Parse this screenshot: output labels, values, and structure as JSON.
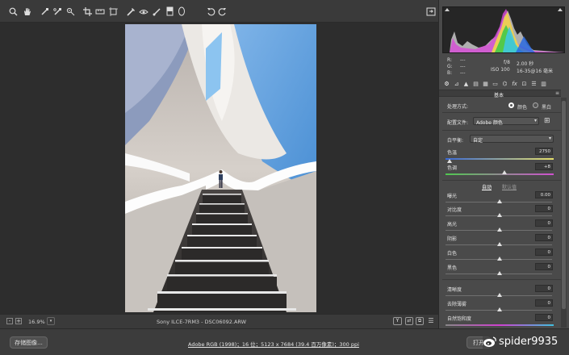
{
  "toolbar": {
    "icons": [
      "zoom-icon",
      "hand-icon",
      "white-balance-icon",
      "color-sampler-icon",
      "target-adjust-icon",
      "crop-icon",
      "straighten-icon",
      "transform-icon",
      "spot-removal-icon",
      "red-eye-icon",
      "adjustment-brush-icon",
      "graduated-filter-icon",
      "radial-filter-icon",
      "rotate-left-icon",
      "rotate-right-icon"
    ],
    "right_icon": "fullscreen-icon"
  },
  "status": {
    "zoom": "16.9%",
    "filename": "Sony ILCE-7RM3  -  DSC06092.ARW"
  },
  "bottom": {
    "save_label": "存储图像...",
    "info_link": "Adobe RGB (1998)；16 位；5123 x 7684 (39.4 百万像素)；300 ppi",
    "open_label": "打开",
    "watermark": "spider9935"
  },
  "histogram": {
    "r_label": "R:",
    "g_label": "G:",
    "b_label": "B:",
    "r_val": "---",
    "g_val": "---",
    "b_val": "---",
    "aperture": "f/8",
    "shutter": "2.00 秒",
    "iso": "ISO 100",
    "lens": "16-35@16 毫米"
  },
  "panel": {
    "section_title": "基本",
    "treatment_label": "处理方式:",
    "color_option": "颜色",
    "bw_option": "黑白",
    "profile_label": "配置文件:",
    "profile_value": "Adobe 颜色",
    "wb_label": "白平衡:",
    "wb_value": "自定",
    "temp_label": "色温",
    "temp_value": "2750",
    "tint_label": "色调",
    "tint_value": "+8",
    "auto_label": "自动",
    "default_label": "默认值",
    "exposure_label": "曝光",
    "exposure_value": "0.00",
    "contrast_label": "对比度",
    "contrast_value": "0",
    "highlights_label": "高光",
    "highlights_value": "0",
    "shadows_label": "阴影",
    "shadows_value": "0",
    "whites_label": "白色",
    "whites_value": "0",
    "blacks_label": "黑色",
    "blacks_value": "0",
    "clarity_label": "清晰度",
    "clarity_value": "0",
    "dehaze_label": "去除薄雾",
    "dehaze_value": "0",
    "vibrance_label": "自然饱和度",
    "vibrance_value": "0"
  },
  "colors": {
    "accent": "#ffffff",
    "panel_bg": "#4a4a4a",
    "canvas_bg": "#2d2d2d"
  }
}
